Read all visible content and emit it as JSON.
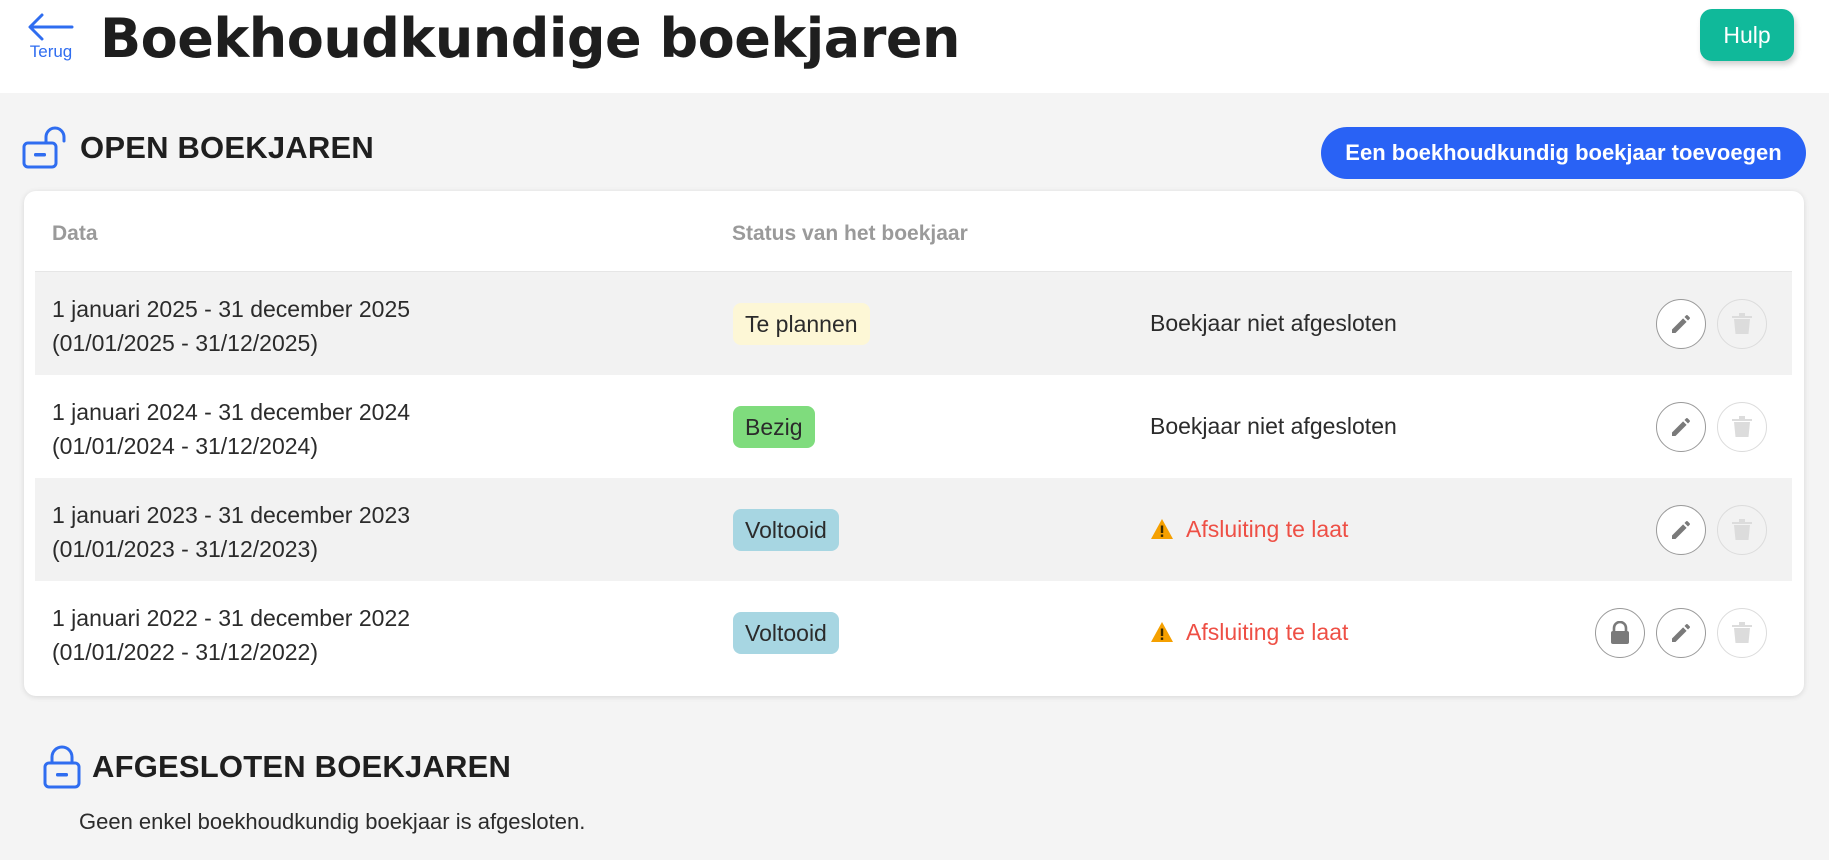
{
  "header": {
    "back_label": "Terug",
    "title": "Boekhoudkundige boekjaren",
    "help_label": "Hulp"
  },
  "open_section": {
    "title": "OPEN BOEKJAREN",
    "add_button_label": "Een boekhoudkundig boekjaar toevoegen",
    "columns": [
      "Data",
      "Status van het boekjaar"
    ],
    "rows": [
      {
        "period": "1 januari 2025 - 31 december 2025",
        "period_short": "(01/01/2025 - 31/12/2025)",
        "status": "Te plannen",
        "closing": "Boekjaar niet afgesloten"
      },
      {
        "period": "1 januari 2024 - 31 december 2024",
        "period_short": "(01/01/2024 - 31/12/2024)",
        "status": "Bezig",
        "closing": "Boekjaar niet afgesloten"
      },
      {
        "period": "1 januari 2023 - 31 december 2023",
        "period_short": "(01/01/2023 - 31/12/2023)",
        "status": "Voltooid",
        "closing": "Afsluiting te laat"
      },
      {
        "period": "1 januari 2022 - 31 december 2022",
        "period_short": "(01/01/2022 - 31/12/2022)",
        "status": "Voltooid",
        "closing": "Afsluiting te laat"
      }
    ]
  },
  "closed_section": {
    "title": "AFGESLOTEN BOEKJAREN",
    "empty_message": "Geen enkel boekhoudkundig boekjaar is afgesloten."
  },
  "colors": {
    "accent": "#2962f5",
    "help": "#10b99a",
    "status_plan": "#fdf7d6",
    "status_busy": "#7fdc7d",
    "status_done": "#a7d6e2",
    "late": "#ee4f45",
    "warning": "#f5a000"
  },
  "icons": [
    "back-arrow-icon",
    "unlock-icon",
    "lock-icon",
    "pencil-icon",
    "trash-icon",
    "warning-icon"
  ]
}
